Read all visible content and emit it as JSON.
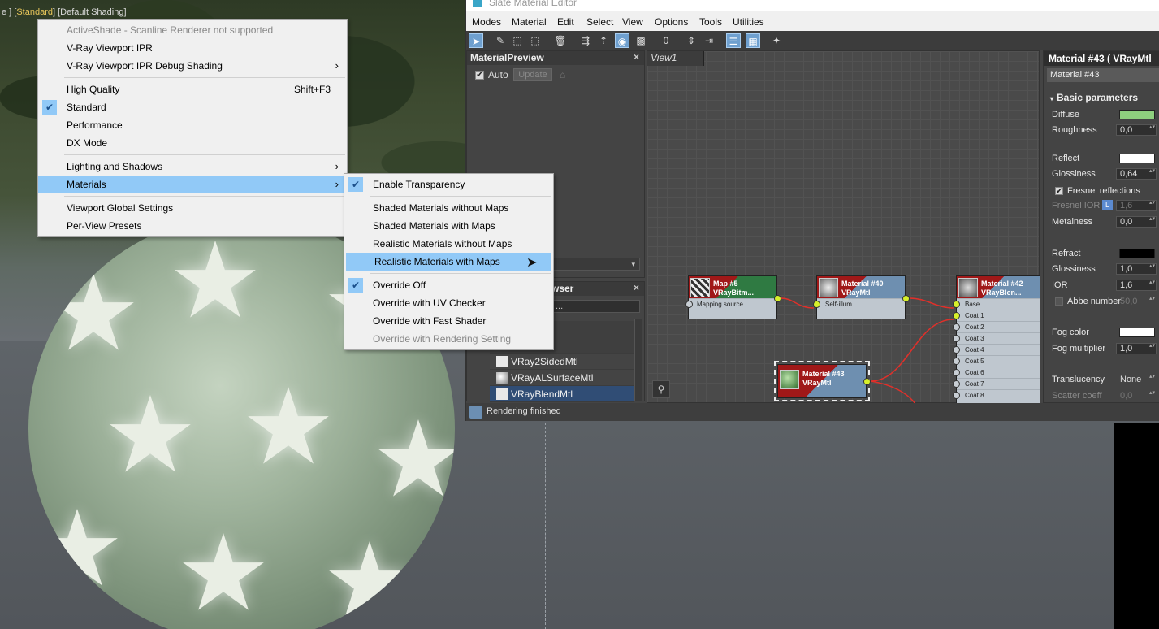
{
  "viewport": {
    "label_prefix": "e ] [",
    "label_shading": "Standard",
    "label_suffix": "] [Default Shading]"
  },
  "menu_main": {
    "items": [
      {
        "label": "ActiveShade - Scanline Renderer not supported",
        "disabled": true
      },
      {
        "label": "V-Ray Viewport IPR"
      },
      {
        "label": "V-Ray Viewport IPR Debug Shading",
        "submenu": true
      },
      {
        "label": "High Quality",
        "shortcut": "Shift+F3"
      },
      {
        "label": "Standard",
        "checked": true
      },
      {
        "label": "Performance"
      },
      {
        "label": "DX Mode"
      },
      {
        "label": "Lighting and Shadows",
        "submenu": true
      },
      {
        "label": "Materials",
        "submenu": true,
        "highlighted": true
      },
      {
        "label": "Viewport Global Settings"
      },
      {
        "label": "Per-View Presets"
      }
    ]
  },
  "menu_sub": {
    "items": [
      {
        "label": "Enable Transparency",
        "checked": true
      },
      {
        "label": "Shaded Materials without Maps"
      },
      {
        "label": "Shaded Materials with Maps"
      },
      {
        "label": "Realistic Materials without Maps"
      },
      {
        "label": "Realistic Materials with Maps",
        "highlighted": true
      },
      {
        "label": "Override Off",
        "checked": true
      },
      {
        "label": "Override with UV Checker"
      },
      {
        "label": "Override with Fast Shader"
      },
      {
        "label": "Override with Rendering Setting",
        "disabled": true
      }
    ]
  },
  "slate": {
    "title": "Slate Material Editor",
    "menus": [
      "Modes",
      "Material",
      "Edit",
      "Select",
      "View",
      "Options",
      "Tools",
      "Utilities"
    ],
    "preview": {
      "title": "MaterialPreview",
      "auto_label": "Auto",
      "update_label": "Update"
    },
    "browser": {
      "title": "wser",
      "search": "...",
      "items": [
        "VRay2SidedMtl",
        "VRayALSurfaceMtl",
        "VRayBlendMtl"
      ]
    },
    "view_tab": "View1",
    "nodes": {
      "map5": {
        "title": "Map #5",
        "sub": "VRayBitm...",
        "slot": "Mapping source"
      },
      "mat40": {
        "title": "Material #40",
        "sub": "VRayMtl",
        "slot": "Self-illum"
      },
      "mat42": {
        "title": "Material #42",
        "sub": "VRayBlen...",
        "slots": [
          "Base",
          "Coat 1",
          "Coat 2",
          "Coat 3",
          "Coat 4",
          "Coat 5",
          "Coat 6",
          "Coat 7",
          "Coat 8"
        ]
      },
      "mat43": {
        "title": "Material #43",
        "sub": "VRayMtl"
      }
    },
    "props": {
      "header": "Material #43  ( VRayMtl",
      "name": "Material #43",
      "section": "Basic parameters",
      "diffuse_label": "Diffuse",
      "roughness_label": "Roughness",
      "roughness": "0,0",
      "reflect_label": "Reflect",
      "glossiness_label": "Glossiness",
      "glossiness": "0,64",
      "fresnel_label": "Fresnel reflections",
      "fresnel_ior_label": "Fresnel IOR",
      "fresnel_ior_lock": "L",
      "fresnel_ior": "1,6",
      "metalness_label": "Metalness",
      "metalness": "0,0",
      "refract_label": "Refract",
      "refr_glossiness_label": "Glossiness",
      "refr_glossiness": "1,0",
      "ior_label": "IOR",
      "ior": "1,6",
      "abbe_label": "Abbe number",
      "abbe": "50,0",
      "fog_color_label": "Fog color",
      "fog_mult_label": "Fog multiplier",
      "fog_mult": "1,0",
      "translucency_label": "Translucency",
      "translucency": "None",
      "scatter_label": "Scatter coeff",
      "scatter": "0,0",
      "colors": {
        "diffuse": "#8ed07e",
        "reflect": "#ffffff",
        "refract": "#000000",
        "fog": "#ffffff"
      }
    },
    "status": "Rendering finished"
  }
}
